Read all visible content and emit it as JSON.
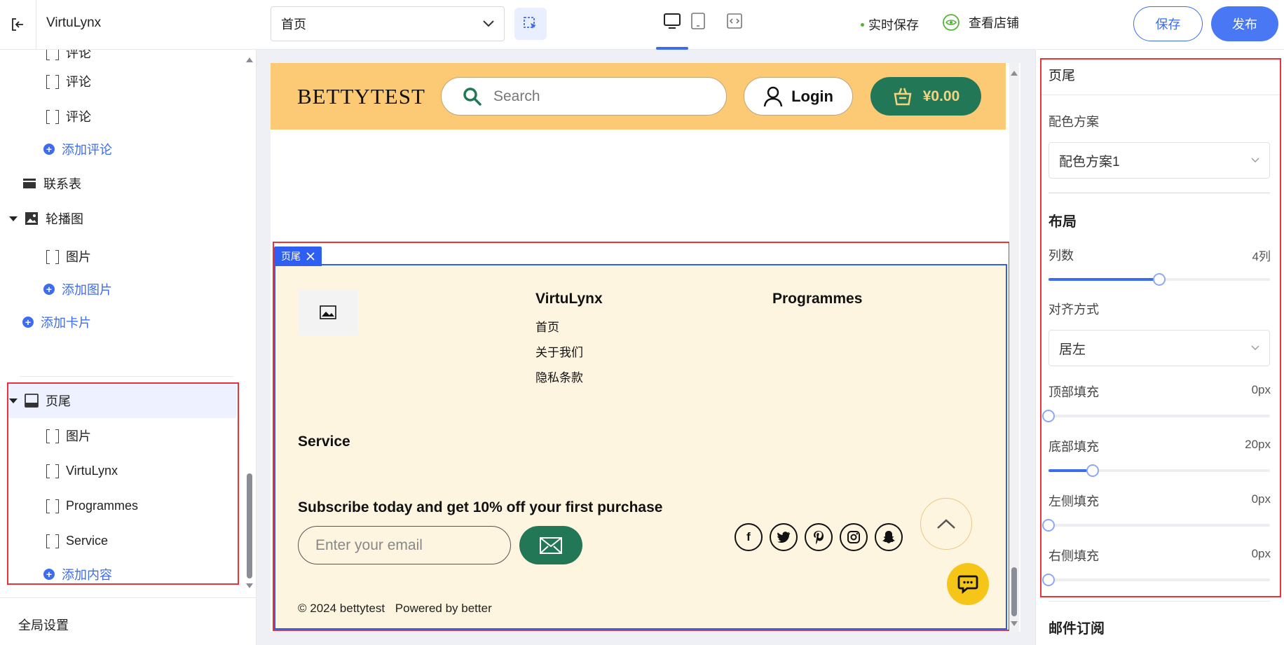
{
  "topbar": {
    "app_title": "VirtuLynx",
    "page_select_value": "首页",
    "autosave_label": "实时保存",
    "view_store_label": "查看店铺",
    "save_label": "保存",
    "publish_label": "发布"
  },
  "sidebar": {
    "items": [
      {
        "label": "评论",
        "kind": "leaf"
      },
      {
        "label": "评论",
        "kind": "leaf"
      },
      {
        "label": "评论",
        "kind": "leaf"
      },
      {
        "label": "添加评论",
        "kind": "add"
      },
      {
        "label": "联系表",
        "kind": "section"
      },
      {
        "label": "轮播图",
        "kind": "section"
      },
      {
        "label": "图片",
        "kind": "leaf"
      },
      {
        "label": "添加图片",
        "kind": "add"
      },
      {
        "label": "添加卡片",
        "kind": "add"
      },
      {
        "label": "页尾",
        "kind": "section"
      },
      {
        "label": "图片",
        "kind": "leaf"
      },
      {
        "label": "VirtuLynx",
        "kind": "leaf"
      },
      {
        "label": "Programmes",
        "kind": "leaf"
      },
      {
        "label": "Service",
        "kind": "leaf"
      },
      {
        "label": "添加内容",
        "kind": "add"
      }
    ],
    "global_settings": "全局设置"
  },
  "canvas": {
    "shop": {
      "brand": "BETTYTEST",
      "search_placeholder": "Search",
      "login_label": "Login",
      "cart_total": "¥0.00"
    },
    "footer_tag": "页尾",
    "footer": {
      "col1_title": "VirtuLynx",
      "col1_links": [
        "首页",
        "关于我们",
        "隐私条款"
      ],
      "col2_title": "Programmes",
      "col3_title": "Service",
      "subscribe_title": "Subscribe today and get 10% off your first purchase",
      "email_placeholder": "Enter your email",
      "social_icons": [
        "facebook-icon",
        "twitter-icon",
        "pinterest-icon",
        "instagram-icon",
        "snapchat-icon"
      ],
      "copyright": "© 2024 bettytest",
      "powered_by": "Powered by better"
    }
  },
  "panel": {
    "title": "页尾",
    "color_scheme_label": "配色方案",
    "color_scheme_value": "配色方案1",
    "layout_heading": "布局",
    "columns_label": "列数",
    "columns_value": "4列",
    "columns_fraction": 0.5,
    "align_label": "对齐方式",
    "align_value": "居左",
    "padding_top_label": "顶部填充",
    "padding_top_value": "0px",
    "padding_bottom_label": "底部填充",
    "padding_bottom_value": "20px",
    "padding_bottom_fraction": 0.2,
    "padding_left_label": "左侧填充",
    "padding_left_value": "0px",
    "padding_right_label": "右侧填充",
    "padding_right_value": "0px",
    "email_subscribe_heading": "邮件订阅"
  },
  "colors": {
    "accent": "#3d6cf0",
    "highlight_red": "#e8323c",
    "shop_header": "#fcca75",
    "shop_green": "#227856",
    "footer_bg": "#fef5e1"
  }
}
